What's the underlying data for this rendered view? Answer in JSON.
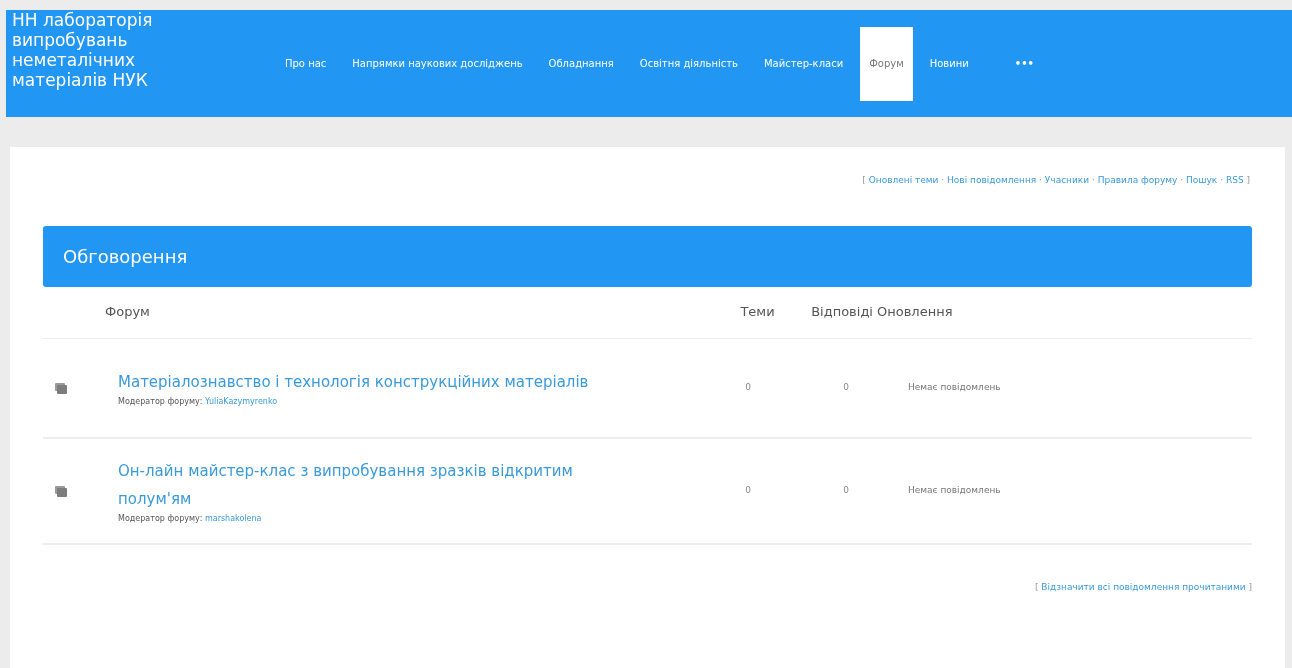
{
  "header": {
    "site_title": "НН лабораторія випробувань неметалічних матеріалів НУК",
    "nav": [
      {
        "label": "Про нас",
        "selected": false,
        "kind": "text"
      },
      {
        "label": "Напрямки наукових досліджень",
        "selected": false,
        "kind": "text"
      },
      {
        "label": "Обладнання",
        "selected": false,
        "kind": "text"
      },
      {
        "label": "Освітня діяльність",
        "selected": false,
        "kind": "text"
      },
      {
        "label": "Майстер-класи",
        "selected": false,
        "kind": "text"
      },
      {
        "label": "Форум",
        "selected": true,
        "kind": "text"
      },
      {
        "label": "Новини",
        "selected": false,
        "kind": "text"
      },
      {
        "label": "•••",
        "selected": false,
        "kind": "more"
      }
    ]
  },
  "top_links": {
    "open": "[",
    "close": "]",
    "separator": "·",
    "links": [
      "Оновлені теми",
      "Нові повідомлення",
      "Учасники",
      "Правила форуму",
      "Пошук",
      "RSS"
    ]
  },
  "category": {
    "title": "Обговорення",
    "columns": [
      "Форум",
      "Теми",
      "Відповіді",
      "Оновлення"
    ],
    "rows": [
      {
        "title": "Матеріалознавство і технологія конструкційних матеріалів",
        "moderator_label": "Модератор форуму:",
        "moderator": "YuliaKazymyrenko",
        "topics": "0",
        "replies": "0",
        "last_update": "Немає повідомлень"
      },
      {
        "title": "Он-лайн майстер-клас з випробування зразків відкритим полум'ям",
        "moderator_label": "Модератор форуму:",
        "moderator": "marshakolena",
        "topics": "0",
        "replies": "0",
        "last_update": "Немає повідомлень"
      }
    ]
  },
  "bottom_link": {
    "open": "[",
    "close": "]",
    "label": "Відзначити всі повідомлення прочитаними"
  }
}
